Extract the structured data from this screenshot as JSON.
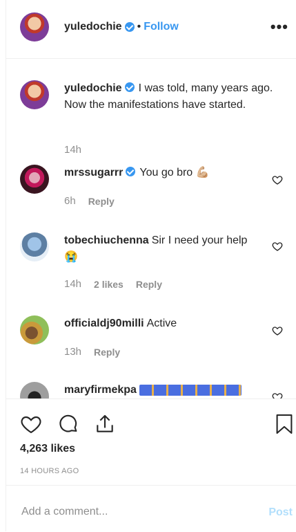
{
  "post_author": {
    "username": "yuledochie",
    "separator": "•",
    "follow_label": "Follow",
    "more_icon": "more-options-icon"
  },
  "caption": {
    "username": "yuledochie",
    "text_line1": "I was told, many years ago.",
    "text_line2": "Now the manifestations have started.",
    "time": "14h"
  },
  "comments": [
    {
      "username": "mrssugarrr",
      "verified": true,
      "text": "You go bro 💪🏼",
      "time": "6h",
      "likes": "",
      "reply_label": "Reply"
    },
    {
      "username": "tobechiuchenna",
      "verified": false,
      "text": "Sir I need your help 😭",
      "time": "14h",
      "likes": "2 likes",
      "reply_label": "Reply"
    },
    {
      "username": "officialdj90milli",
      "verified": false,
      "text": "Active",
      "time": "13h",
      "likes": "",
      "reply_label": "Reply"
    },
    {
      "username": "maryfirmekpa",
      "verified": false,
      "text": "🙌🙌🙌🙌🙌🙌🙌",
      "time": "",
      "likes": "",
      "reply_label": ""
    }
  ],
  "actions": {
    "likes_count": "4,263 likes",
    "time_ago": "14 HOURS AGO"
  },
  "add_comment": {
    "placeholder": "Add a comment...",
    "post_label": "Post"
  },
  "colors": {
    "link_blue": "#3897f0",
    "post_disabled": "#b2dffc",
    "muted": "#8e8e8e"
  }
}
